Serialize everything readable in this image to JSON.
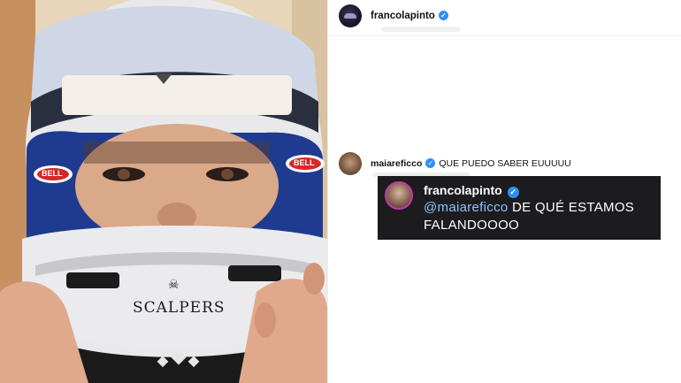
{
  "post": {
    "author_username": "francolapinto",
    "verified_icon": "verified-badge-icon",
    "accent_color": "#2f8ff7"
  },
  "photo": {
    "helmet_brand_label": "SCALPERS",
    "visor_badge_label": "BELL",
    "helmet_icons": [
      "skull-icon",
      "binance-logo-icon"
    ]
  },
  "comment": {
    "username": "maiareficco",
    "text": "QUE PUEDO SABER EUUUUU"
  },
  "reply_card": {
    "username": "francolapinto",
    "mention": "@maiareficco",
    "text": " DE QUÉ ESTAMOS FALANDOOOO",
    "mention_color": "#8ec0ff",
    "background": "#1c1c1e"
  }
}
